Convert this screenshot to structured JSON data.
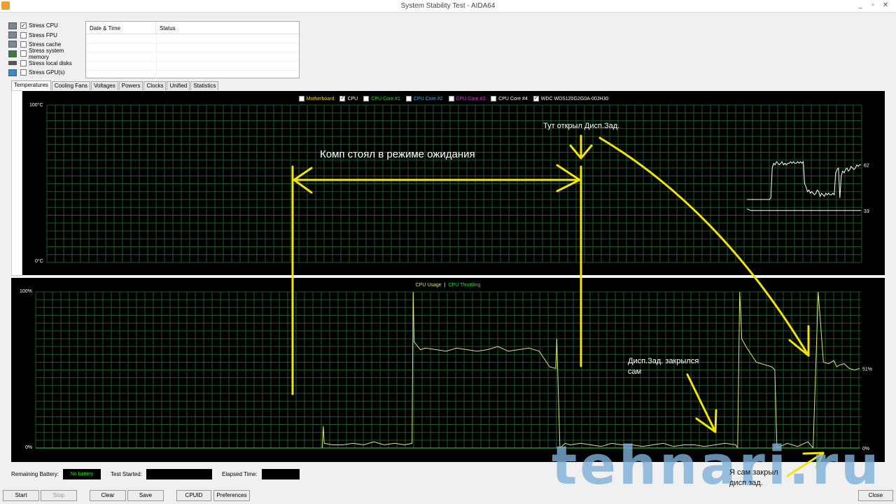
{
  "window": {
    "title": "System Stability Test - AIDA64"
  },
  "stress": [
    {
      "label": "Stress CPU",
      "checked": true
    },
    {
      "label": "Stress FPU",
      "checked": false
    },
    {
      "label": "Stress cache",
      "checked": false
    },
    {
      "label": "Stress system memory",
      "checked": false
    },
    {
      "label": "Stress local disks",
      "checked": false
    },
    {
      "label": "Stress GPU(s)",
      "checked": false
    }
  ],
  "log": {
    "col_datetime": "Date & Time",
    "col_status": "Status"
  },
  "tabs": [
    "Temperatures",
    "Cooling Fans",
    "Voltages",
    "Powers",
    "Clocks",
    "Unified",
    "Statistics"
  ],
  "temp_legend": [
    {
      "label": "Motherboard",
      "checked": false,
      "color": "#e8d84a"
    },
    {
      "label": "CPU",
      "checked": true,
      "color": "#ffffff"
    },
    {
      "label": "CPU Core #1",
      "checked": false,
      "color": "#39d939"
    },
    {
      "label": "CPU Core #2",
      "checked": false,
      "color": "#38b8e8"
    },
    {
      "label": "CPU Core #3",
      "checked": false,
      "color": "#e838e8"
    },
    {
      "label": "CPU Core #4",
      "checked": false,
      "color": "#ffffff"
    },
    {
      "label": "WDC WDS120G2G0A-00JH30",
      "checked": true,
      "color": "#ffffff"
    }
  ],
  "usage_legend": {
    "usage": "CPU Usage",
    "sep": "|",
    "throttling": "CPU Throttling"
  },
  "chart_data": [
    {
      "type": "line",
      "title": "",
      "ylim": [
        0,
        100
      ],
      "y_top_label": "100°C",
      "y_bottom_label": "0°C",
      "grid": true,
      "series": [
        {
          "name": "CPU",
          "color": "#ffffff",
          "current_label": "62",
          "x": [
            0,
            2,
            4,
            6,
            8,
            10,
            12,
            14,
            16,
            18,
            20,
            22,
            24,
            26,
            28,
            30,
            32,
            34,
            36,
            38,
            40,
            42,
            44,
            46,
            48,
            50,
            52,
            54,
            56,
            58,
            60,
            62,
            64,
            66,
            68,
            70,
            72,
            74,
            76,
            78,
            80,
            82,
            84,
            86,
            88,
            90,
            92,
            94,
            96,
            98,
            100,
            102,
            104,
            106,
            108,
            110,
            112,
            114,
            116,
            118,
            120,
            122,
            124,
            126,
            128,
            130,
            132,
            134,
            136,
            138,
            140,
            142,
            144,
            146,
            148,
            150,
            152,
            154,
            156,
            158,
            160,
            162
          ],
          "values": [
            40,
            40,
            40,
            40,
            40,
            40,
            40,
            40,
            40,
            40,
            40,
            40,
            40,
            40,
            40,
            40,
            40,
            41,
            60,
            63,
            62,
            64,
            63,
            62,
            63,
            64,
            62,
            63,
            62,
            63,
            63,
            64,
            63,
            64,
            63,
            63,
            64,
            63,
            64,
            63,
            64,
            50,
            48,
            45,
            46,
            44,
            45,
            44,
            43,
            44,
            46,
            45,
            42,
            44,
            43,
            42,
            44,
            43,
            44,
            43,
            43,
            44,
            43,
            57,
            59,
            60,
            41,
            55,
            58,
            57,
            59,
            60,
            58,
            59,
            61,
            60,
            59,
            60,
            62,
            61,
            62,
            62
          ]
        },
        {
          "name": "WDC WDS120G2G0A-00JH30",
          "color": "#ffffff",
          "current_label": "33",
          "x": [
            0,
            6,
            12,
            18,
            24,
            30,
            36,
            42,
            48,
            54,
            60,
            66,
            72,
            78,
            84,
            90,
            96,
            102,
            108,
            114,
            120,
            126,
            132,
            138,
            144,
            150,
            156,
            162
          ],
          "values": [
            34,
            33,
            33,
            33,
            33,
            33,
            33,
            33,
            33,
            33,
            33,
            33,
            33,
            33,
            33,
            33,
            33,
            33,
            33,
            33,
            33,
            33,
            33,
            33,
            33,
            33,
            33,
            33
          ]
        }
      ]
    },
    {
      "type": "line",
      "title": "",
      "ylim": [
        0,
        100
      ],
      "y_top_label": "100%",
      "y_bottom_label": "0%",
      "grid": true,
      "series": [
        {
          "name": "CPU Usage",
          "color": "#d8e87a",
          "current_label": "51%",
          "x": [
            0,
            30,
            31,
            32,
            40,
            50,
            60,
            70,
            80,
            90,
            100,
            110,
            117,
            118,
            119,
            125,
            130,
            140,
            150,
            160,
            170,
            180,
            190,
            200,
            210,
            220,
            230,
            240,
            250,
            256,
            257,
            260,
            265,
            270,
            280,
            290,
            300,
            310,
            320,
            330,
            340,
            350,
            360,
            370,
            380,
            390,
            400,
            410,
            420,
            430,
            432,
            434,
            436,
            440,
            445,
            450,
            455,
            460,
            465,
            468,
            470,
            480,
            490,
            500,
            505,
            510,
            515,
            520,
            525,
            528,
            530,
            535,
            540,
            545,
            550
          ],
          "values": [
            0,
            0,
            14,
            3,
            2,
            2,
            3,
            2,
            4,
            2,
            3,
            2,
            3,
            100,
            68,
            63,
            64,
            63,
            62,
            64,
            63,
            62,
            63,
            65,
            62,
            63,
            64,
            62,
            52,
            51,
            70,
            0,
            3,
            2,
            3,
            2,
            1,
            3,
            2,
            2,
            1,
            2,
            3,
            1,
            2,
            2,
            1,
            2,
            3,
            2,
            0,
            100,
            70,
            65,
            60,
            55,
            54,
            53,
            52,
            50,
            0,
            3,
            1,
            4,
            0,
            100,
            55,
            54,
            56,
            52,
            53,
            54,
            51,
            50,
            51
          ]
        },
        {
          "name": "CPU Throttling",
          "color": "#39d939",
          "current_label": "0%",
          "x": [
            0,
            550
          ],
          "values": [
            0,
            0
          ]
        }
      ]
    }
  ],
  "annotations": {
    "standby": "Комп стоял в режиме ожидания",
    "opened": "Тут открыл Дисп.Зад.",
    "closed_self_1": "Дисп.Зад. закрылся",
    "closed_self_2": "сам",
    "closed_me_1": "Я сам закрыл",
    "closed_me_2": "дисп.зад."
  },
  "status": {
    "battery_label": "Remaining Battery:",
    "battery_value": "No battery",
    "test_started_label": "Test Started:",
    "test_started_value": "",
    "elapsed_label": "Elapsed Time:",
    "elapsed_value": ""
  },
  "buttons": {
    "start": "Start",
    "stop": "Stop",
    "clear": "Clear",
    "save": "Save",
    "cpuid": "CPUID",
    "preferences": "Preferences",
    "close": "Close"
  },
  "watermark": "tehnari.ru"
}
